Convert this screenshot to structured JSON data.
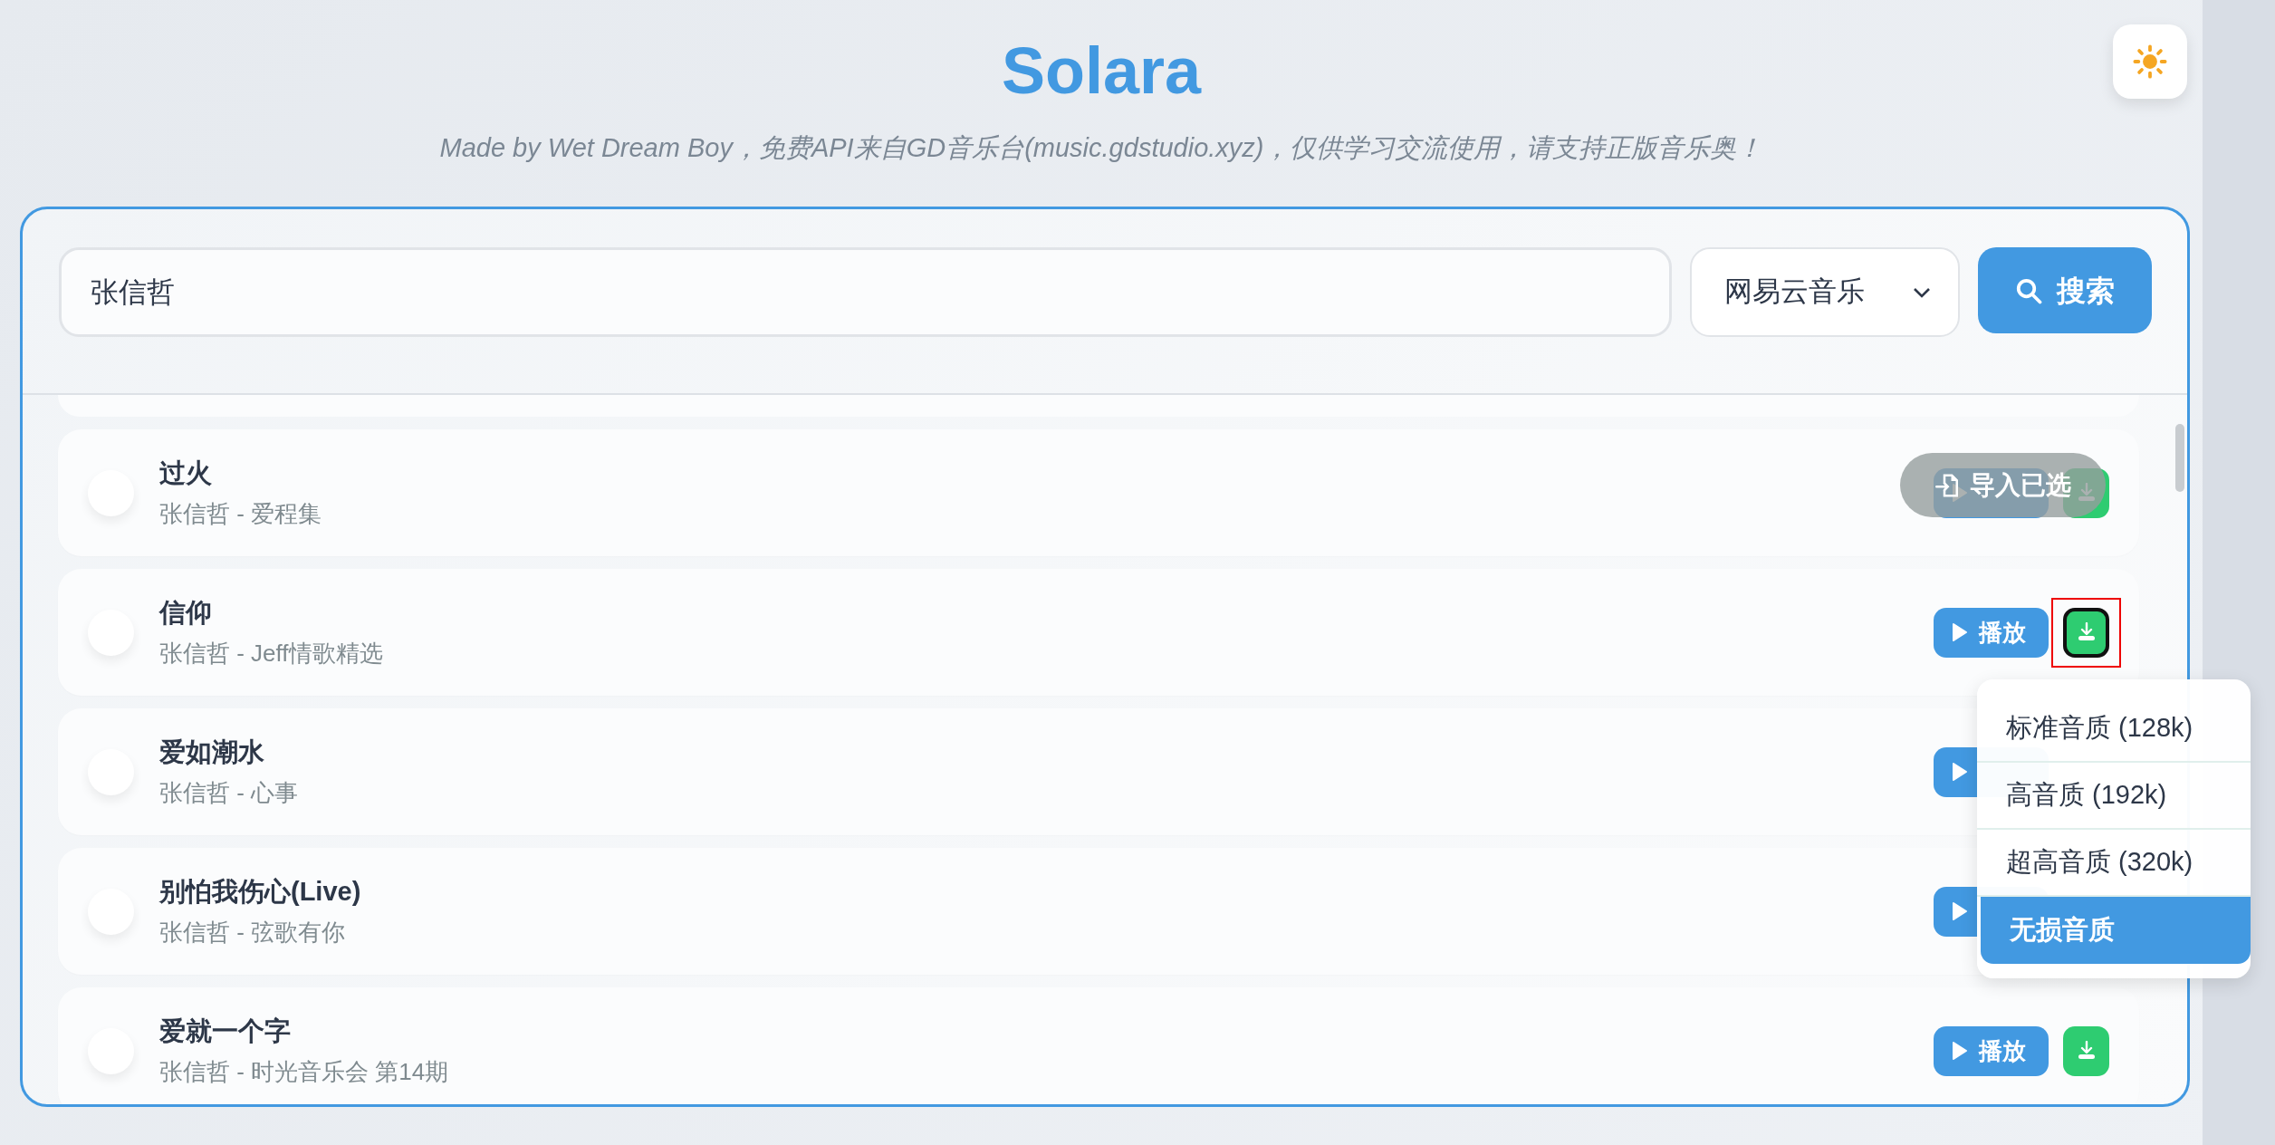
{
  "app": {
    "title": "Solara",
    "subtitle": "Made by Wet Dream Boy，免费API来自GD音乐台(music.gdstudio.xyz)，仅供学习交流使用，请支持正版音乐奥！"
  },
  "search": {
    "value": "张信哲",
    "source": "网易云音乐",
    "button": "搜索"
  },
  "songs": [
    {
      "title": "过火",
      "subtitle": "张信哲 - 爱程集",
      "focused": false
    },
    {
      "title": "信仰",
      "subtitle": "张信哲 - Jeff情歌精选",
      "play_label": "播放",
      "focused": true
    },
    {
      "title": "爱如潮水",
      "subtitle": "张信哲 - 心事"
    },
    {
      "title": "别怕我伤心(Live)",
      "subtitle": "张信哲 - 弦歌有你"
    },
    {
      "title": "爱就一个字",
      "subtitle": "张信哲 - 时光音乐会 第14期",
      "play_label": "播放",
      "focused": false
    }
  ],
  "import_button": {
    "label": "导入已选"
  },
  "quality_menu": {
    "items": [
      {
        "label": "标准音质 (128k)",
        "selected": false
      },
      {
        "label": "高音质 (192k)",
        "selected": false
      },
      {
        "label": "超高音质 (320k)",
        "selected": false
      },
      {
        "label": "无损音质",
        "selected": true
      }
    ]
  }
}
